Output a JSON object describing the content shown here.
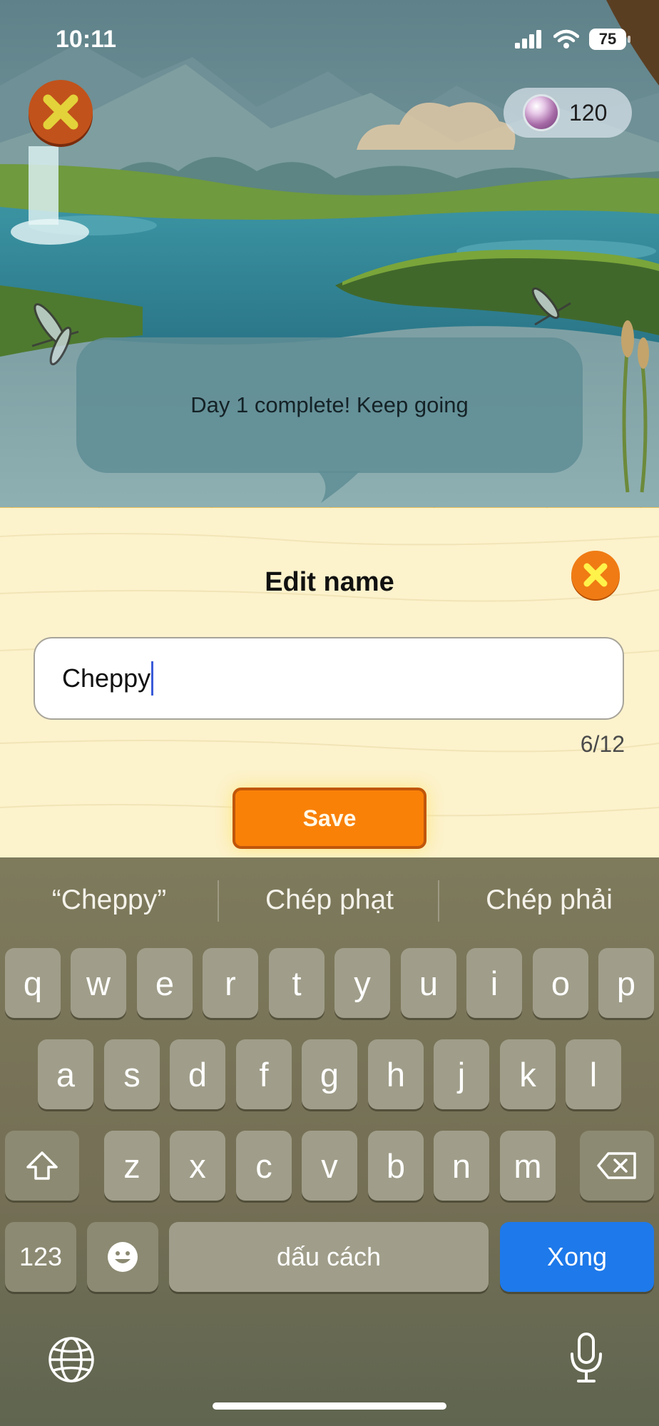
{
  "status_bar": {
    "time": "10:11",
    "battery": "75"
  },
  "game": {
    "gem_count": "120",
    "bubble_text": "Day 1 complete! Keep going"
  },
  "edit_panel": {
    "title": "Edit name",
    "name_value": "Cheppy",
    "char_counter": "6/12",
    "save_label": "Save"
  },
  "keyboard": {
    "suggestions": [
      "“Cheppy”",
      "Chép phạt",
      "Chép phải"
    ],
    "row1": [
      "q",
      "w",
      "e",
      "r",
      "t",
      "y",
      "u",
      "i",
      "o",
      "p"
    ],
    "row2": [
      "a",
      "s",
      "d",
      "f",
      "g",
      "h",
      "j",
      "k",
      "l"
    ],
    "row3": [
      "z",
      "x",
      "c",
      "v",
      "b",
      "n",
      "m"
    ],
    "numbers_label": "123",
    "space_label": "dấu cách",
    "return_label": "Xong"
  },
  "colors": {
    "panel_bg": "#fcf2cc",
    "save_orange": "#f98108",
    "return_blue": "#1e79ea",
    "close_orange": "#f07b14"
  }
}
